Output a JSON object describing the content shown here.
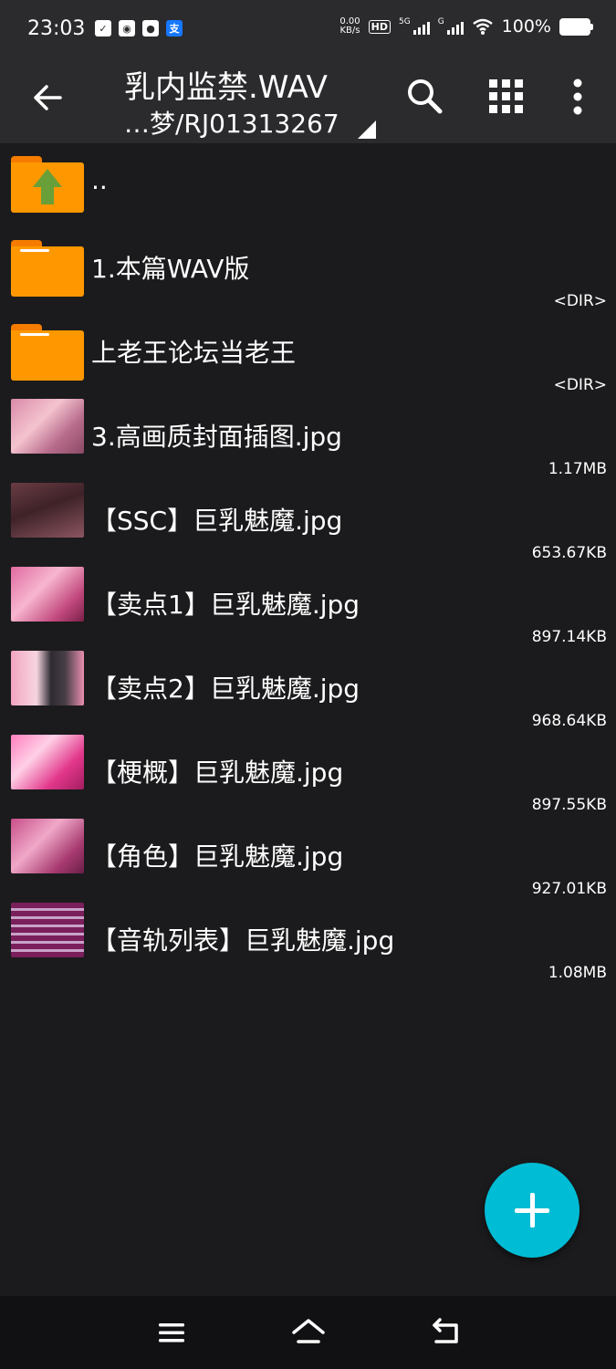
{
  "status_bar": {
    "time": "23:03",
    "speed_value": "0.00",
    "speed_unit": "KB/s",
    "hd": "HD",
    "net1": "5G",
    "net2": "G",
    "battery": "100%",
    "left_icons": [
      "clipboard-check-icon",
      "app-badge-icon",
      "wechat-icon",
      "alipay-icon"
    ],
    "alipay_glyph": "支"
  },
  "toolbar": {
    "title": "乳内监禁.WAV",
    "path": "…梦/RJ01313267"
  },
  "files": [
    {
      "name": "..",
      "size": "",
      "kind": "parent"
    },
    {
      "name": "1.本篇WAV版",
      "size": "<DIR>",
      "kind": "folder"
    },
    {
      "name": "上老王论坛当老王",
      "size": "<DIR>",
      "kind": "folder"
    },
    {
      "name": "3.高画质封面插图.jpg",
      "size": "1.17MB",
      "kind": "image"
    },
    {
      "name": "【SSC】巨乳魅魔.jpg",
      "size": "653.67KB",
      "kind": "image"
    },
    {
      "name": "【卖点1】巨乳魅魔.jpg",
      "size": "897.14KB",
      "kind": "image"
    },
    {
      "name": "【卖点2】巨乳魅魔.jpg",
      "size": "968.64KB",
      "kind": "image"
    },
    {
      "name": "【梗概】巨乳魅魔.jpg",
      "size": "897.55KB",
      "kind": "image"
    },
    {
      "name": "【角色】巨乳魅魔.jpg",
      "size": "927.01KB",
      "kind": "image"
    },
    {
      "name": "【音轨列表】巨乳魅魔.jpg",
      "size": "1.08MB",
      "kind": "image"
    }
  ],
  "colors": {
    "background": "#1b1b1d",
    "toolbar": "#2b2b2d",
    "folder": "#ff9800",
    "fab": "#00bcd4",
    "up_arrow": "#689f38"
  }
}
